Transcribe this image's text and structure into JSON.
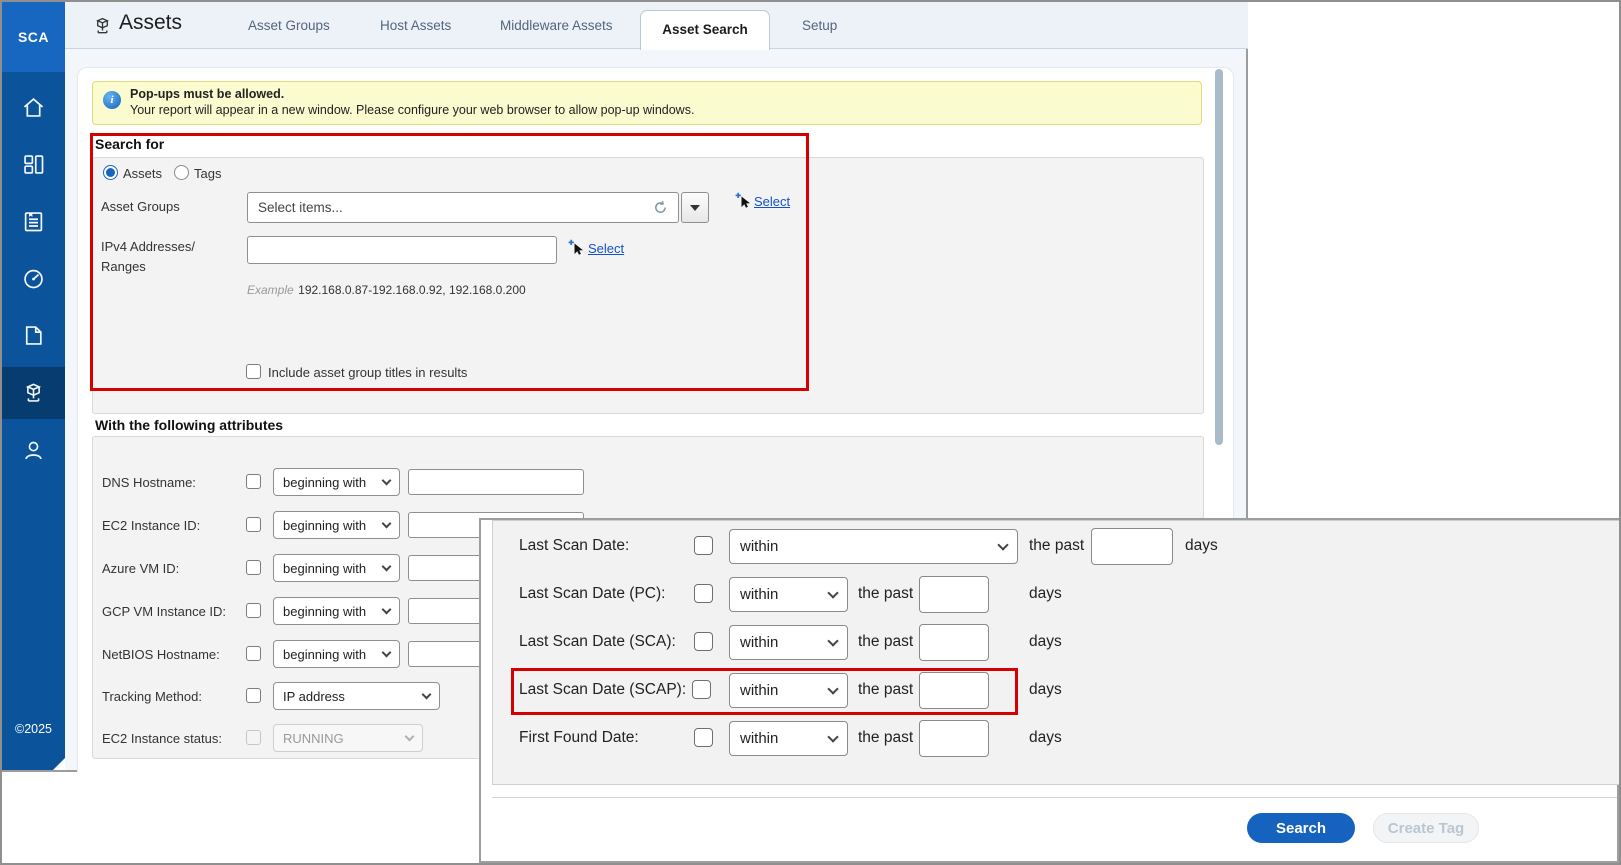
{
  "app": {
    "logo": "SCA",
    "copyright": "©2025"
  },
  "sidebar": {
    "icons": [
      "home",
      "modules",
      "reports",
      "scans",
      "policies",
      "assets",
      "users"
    ]
  },
  "header": {
    "title": "Assets",
    "tabs": {
      "t0": "Asset Groups",
      "t1": "Host Assets",
      "t2": "Middleware Assets",
      "t3": "Asset Search",
      "t4": "Setup"
    },
    "active_tab": "Asset Search"
  },
  "banner": {
    "title": "Pop-ups must be allowed.",
    "body": "Your report will appear in a new window. Please configure your web browser to allow pop-up windows."
  },
  "search_for": {
    "heading": "Search for",
    "radio_assets": "Assets",
    "radio_tags": "Tags",
    "asset_groups_label": "Asset Groups",
    "asset_groups_placeholder": "Select items...",
    "select_link": "Select",
    "ipv4_label_line1": "IPv4 Addresses/",
    "ipv4_label_line2": "Ranges",
    "example_label": "Example",
    "example_value": "192.168.0.87-192.168.0.92, 192.168.0.200",
    "include_checkbox_label": "Include asset group titles in results"
  },
  "attributes": {
    "heading": "With the following attributes",
    "operator": "beginning with",
    "rows": [
      {
        "label": "DNS Hostname:"
      },
      {
        "label": "EC2 Instance ID:"
      },
      {
        "label": "Azure VM ID:"
      },
      {
        "label": "GCP VM Instance ID:"
      },
      {
        "label": "NetBIOS Hostname:"
      }
    ],
    "tracking_method": {
      "label": "Tracking Method:",
      "value": "IP address"
    },
    "ec2_status": {
      "label": "EC2 Instance status:",
      "value": "RUNNING"
    }
  },
  "overlay": {
    "within": "within",
    "the_past": "the past",
    "days": "days",
    "rows": [
      {
        "label": "Last Scan Date:"
      },
      {
        "label": "Last Scan Date (PC):"
      },
      {
        "label": "Last Scan Date (SCA):"
      },
      {
        "label": "Last Scan Date (SCAP):"
      },
      {
        "label": "First Found Date:"
      }
    ],
    "search_button": "Search",
    "create_tag_button": "Create Tag"
  },
  "colors": {
    "accent_blue": "#1565c0",
    "annotation_red": "#d50000",
    "sidebar_blue": "#0b549b",
    "logo_blue": "#1767c0",
    "banner_yellow": "#fbfbd0",
    "link_blue": "#1451c8"
  }
}
